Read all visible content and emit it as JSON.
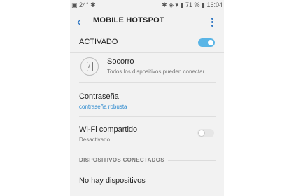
{
  "status_bar": {
    "left": "▣ 24° ✱",
    "right": "✱ ◈ ▾ ▮ 71 % ▮ 16:04"
  },
  "header": {
    "back_icon": "back-arrow-icon",
    "title": "MOBILE HOTSPOT",
    "more_icon": "more-vertical-icon"
  },
  "main_toggle": {
    "label": "ACTIVADO",
    "checked": true
  },
  "network": {
    "name": "Socorro",
    "description": "Todos los dispositivos pueden conectar...",
    "icon": "phone-icon"
  },
  "password": {
    "label": "Contraseña",
    "value": "contraseña robusta"
  },
  "wifi_sharing": {
    "label": "Wi-Fi compartido",
    "status": "Desactivado",
    "checked": false
  },
  "connected": {
    "header": "DISPOSITIVOS CONECTADOS",
    "empty_text": "No hay dispositivos"
  },
  "colors": {
    "accent": "#5ab5e6",
    "link": "#2f8bcf",
    "back": "#2f76c3"
  }
}
